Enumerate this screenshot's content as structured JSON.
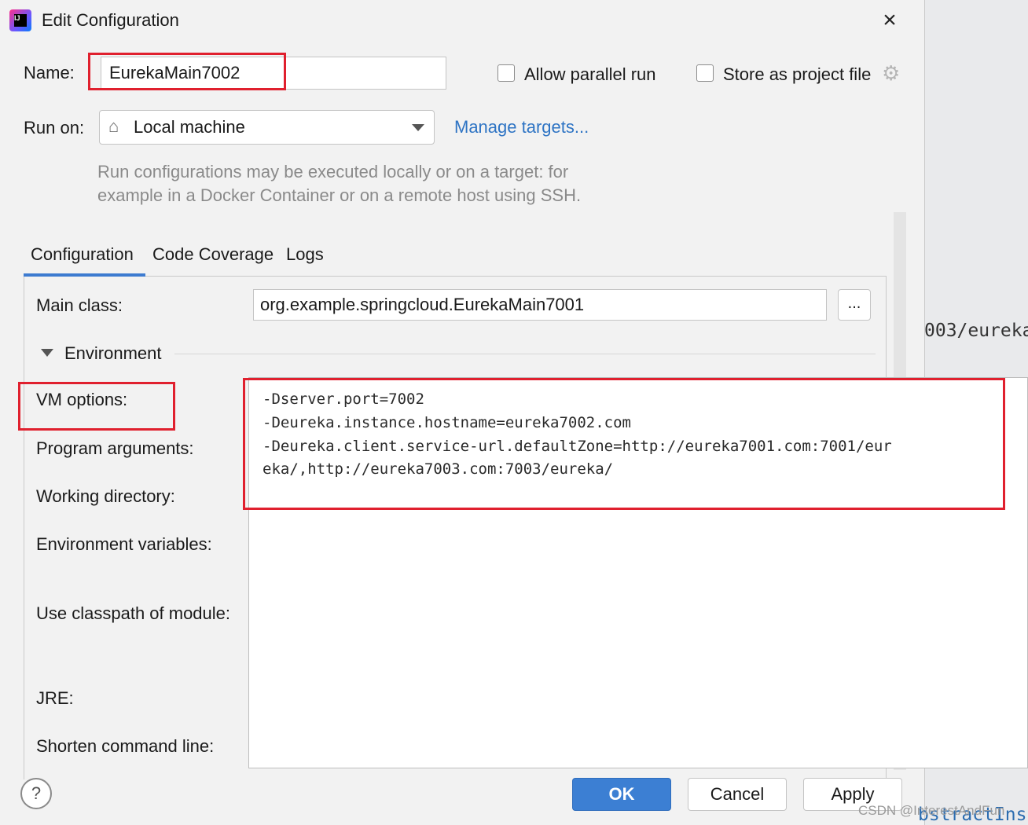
{
  "window": {
    "title": "Edit Configuration"
  },
  "name": {
    "label": "Name:",
    "value": "EurekaMain7002"
  },
  "options": {
    "allow_parallel_label": "Allow parallel run",
    "store_as_project_label": "Store as project file",
    "allow_parallel_checked": false,
    "store_as_project_checked": false
  },
  "run_on": {
    "label": "Run on:",
    "value": "Local machine",
    "manage_link": "Manage targets..."
  },
  "hint": {
    "line1": "Run configurations may be executed locally or on a target: for",
    "line2": "example in a Docker Container or on a remote host using SSH."
  },
  "tabs": [
    {
      "label": "Configuration",
      "active": true
    },
    {
      "label": "Code Coverage",
      "active": false
    },
    {
      "label": "Logs",
      "active": false
    }
  ],
  "main_class": {
    "label": "Main class:",
    "value": "org.example.springcloud.EurekaMain7001",
    "browse_label": "..."
  },
  "environment": {
    "label": "Environment"
  },
  "fields": {
    "vm_options_label": "VM options:",
    "program_arguments_label": "Program arguments:",
    "working_directory_label": "Working directory:",
    "environment_variables_label": "Environment variables:",
    "classpath_label": "Use classpath of module:",
    "jre_label": "JRE:",
    "shorten_label": "Shorten command line:"
  },
  "vm_options": {
    "lines": [
      "-Dserver.port=7002",
      "-Deureka.instance.hostname=eureka7002.com",
      "-Deureka.client.service-url.defaultZone=http://eureka7001.com:7001/eur",
      "eka/,http://eureka7003.com:7003/eureka/"
    ]
  },
  "buttons": {
    "help": "?",
    "ok": "OK",
    "cancel": "Cancel",
    "apply": "Apply"
  },
  "background": {
    "code_fragment_1": "003/eureka",
    "code_fragment_2": "bstractIns",
    "watermark": "CSDN @InterestAndFun"
  },
  "colors": {
    "accent": "#3c7fd3",
    "highlight_red": "#e0202e",
    "link": "#2e74c4"
  },
  "icons": [
    "intellij-icon",
    "close-icon",
    "gear-icon",
    "home-icon",
    "dropdown-arrow-icon",
    "expand-triangle-icon",
    "help-icon"
  ]
}
